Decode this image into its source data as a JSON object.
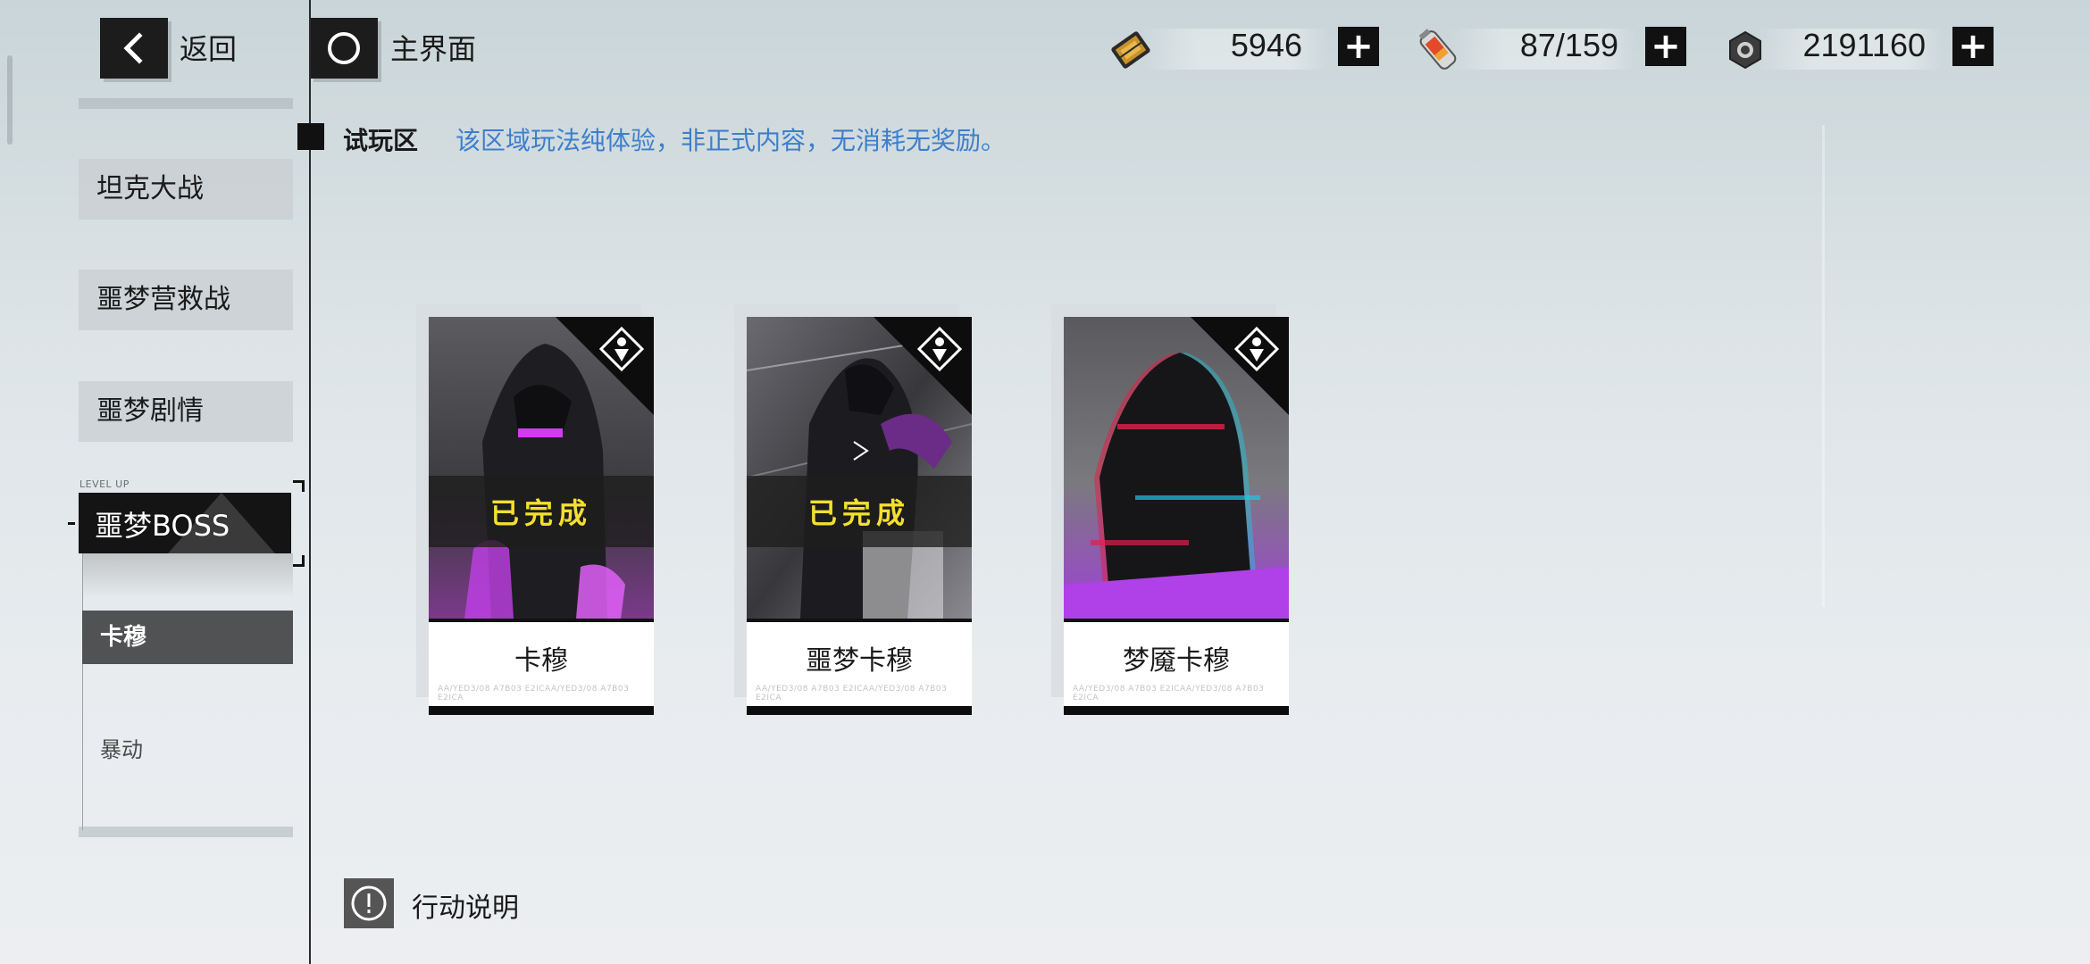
{
  "header": {
    "back_label": "返回",
    "home_label": "主界面",
    "resources": [
      {
        "icon": "stamina-ticket-icon",
        "value": "5946"
      },
      {
        "icon": "battery-capsule-icon",
        "value": "87/159"
      },
      {
        "icon": "gear-nut-icon",
        "value": "2191160"
      }
    ]
  },
  "sidebar": {
    "items": [
      {
        "label": "坦克大战"
      },
      {
        "label": "噩梦营救战"
      },
      {
        "label": "噩梦剧情"
      }
    ],
    "active_item": {
      "label": "噩梦BOSS",
      "tag": "LEVEL UP"
    },
    "sub_items": [
      {
        "label": "卡穆",
        "active": true
      },
      {
        "label": "暴动",
        "active": false
      }
    ]
  },
  "trial": {
    "title": "试玩区",
    "notice": "该区域玩法纯体验，非正式内容，无消耗无奖励。"
  },
  "cards": [
    {
      "name": "卡穆",
      "status": "已完成",
      "completed": true,
      "fine_print": "AA/YED3/08 A7B03 E2ICAA/YED3/08 A7B03 E2ICA"
    },
    {
      "name": "噩梦卡穆",
      "status": "已完成",
      "completed": true,
      "fine_print": "AA/YED3/08 A7B03 E2ICAA/YED3/08 A7B03 E2ICA"
    },
    {
      "name": "梦魇卡穆",
      "status": "",
      "completed": false,
      "fine_print": "AA/YED3/08 A7B03 E2ICAA/YED3/08 A7B03 E2ICA"
    }
  ],
  "footer": {
    "info_label": "行动说明"
  },
  "colors": {
    "accent_notice": "#3d7fcc",
    "completed_text": "#f4df2e",
    "dark": "#111111"
  }
}
